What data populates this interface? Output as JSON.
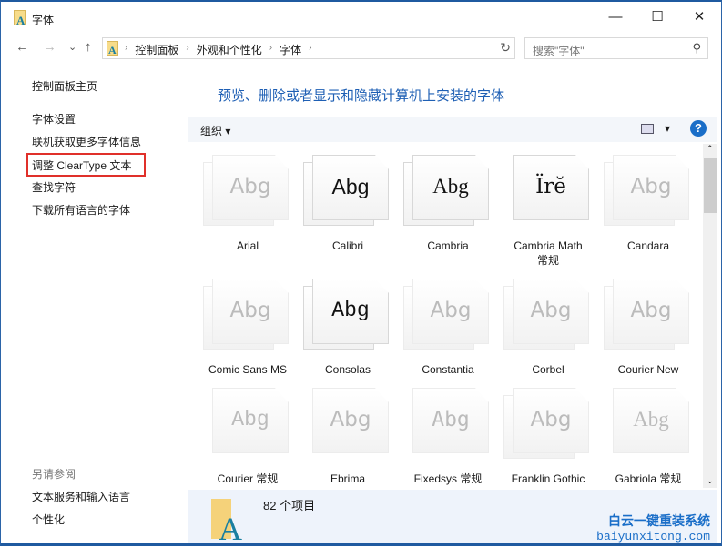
{
  "window": {
    "title": "字体",
    "minimize": "—",
    "maximize": "☐",
    "close": "✕"
  },
  "nav": {
    "back": "←",
    "forward": "→",
    "recent": "⌄",
    "up": "↑",
    "breadcrumbs": [
      "控制面板",
      "外观和个性化",
      "字体"
    ],
    "refresh": "↻",
    "search_placeholder": "搜索\"字体\""
  },
  "sidebar": {
    "items": [
      "控制面板主页",
      "字体设置",
      "联机获取更多字体信息",
      "调整 ClearType 文本",
      "查找字符",
      "下载所有语言的字体"
    ],
    "see_also": "另请参阅",
    "see_also_items": [
      "文本服务和输入语言",
      "个性化"
    ],
    "highlighted": "调整 ClearType 文本",
    "highlight_color": "#e0302a"
  },
  "main": {
    "heading": "预览、删除或者显示和隐藏计算机上安装的字体",
    "organize": "组织 ▾",
    "view_dropdown": "▾",
    "help": "?"
  },
  "fonts": [
    {
      "name": "Arial",
      "sample": "Abg",
      "faded": true,
      "stacked": true
    },
    {
      "name": "Calibri",
      "sample": "Abg",
      "faded": false,
      "stacked": true
    },
    {
      "name": "Cambria",
      "sample": "Abg",
      "faded": false,
      "stacked": true
    },
    {
      "name": "Cambria Math\n常规",
      "sample": "Ïrĕ",
      "faded": false,
      "stacked": false
    },
    {
      "name": "Candara",
      "sample": "Abg",
      "faded": true,
      "stacked": true
    },
    {
      "name": "Comic Sans MS",
      "sample": "Abg",
      "faded": true,
      "stacked": true
    },
    {
      "name": "Consolas",
      "sample": "Abg",
      "faded": false,
      "stacked": true
    },
    {
      "name": "Constantia",
      "sample": "Abg",
      "faded": true,
      "stacked": true
    },
    {
      "name": "Corbel",
      "sample": "Abg",
      "faded": true,
      "stacked": true
    },
    {
      "name": "Courier New",
      "sample": "Abg",
      "faded": true,
      "stacked": true
    },
    {
      "name": "Courier 常规",
      "sample": "Abg",
      "faded": true,
      "stacked": false
    },
    {
      "name": "Ebrima",
      "sample": "Abg",
      "faded": true,
      "stacked": false
    },
    {
      "name": "Fixedsys 常规",
      "sample": "Abg",
      "faded": true,
      "stacked": false
    },
    {
      "name": "Franklin Gothic",
      "sample": "Abg",
      "faded": true,
      "stacked": true
    },
    {
      "name": "Gabriola 常规",
      "sample": "Abg",
      "faded": true,
      "stacked": false
    }
  ],
  "status": {
    "count": "82 个项目"
  },
  "watermark": {
    "cn": "白云一键重装系统",
    "url": "baiyunxitong.com"
  },
  "colors": {
    "accent": "#1e5fb4",
    "window_border": "#1f5aa0"
  }
}
